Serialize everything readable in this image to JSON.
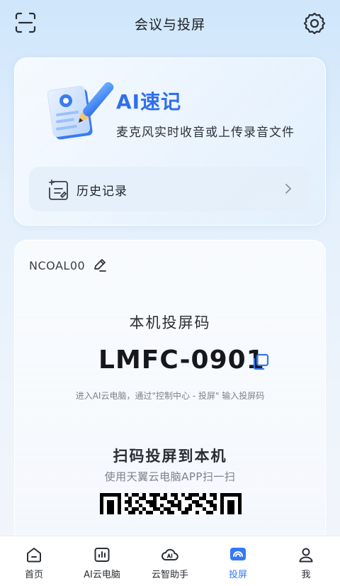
{
  "header": {
    "title": "会议与投屏",
    "scan_icon": "scan-icon",
    "settings_icon": "gear-icon"
  },
  "ai_card": {
    "title": "AI速记",
    "subtitle": "麦克风实时收音或上传录音文件",
    "history_label": "历史记录",
    "accent_color": "#2f6fed"
  },
  "projection": {
    "device_name": "NCOAL00",
    "code_title": "本机投屏码",
    "code": "LMFC-0901",
    "hint": "进入AI云电脑，通过\"控制中心 - 投屏\" 输入投屏码",
    "scan_title": "扫码投屏到本机",
    "scan_subtitle": "使用天翼云电脑APP扫一扫"
  },
  "nav": {
    "items": [
      {
        "label": "首页",
        "icon": "home-icon"
      },
      {
        "label": "AI云电脑",
        "icon": "chart-icon"
      },
      {
        "label": "云智助手",
        "icon": "ai-cloud-icon"
      },
      {
        "label": "投屏",
        "icon": "cast-icon"
      },
      {
        "label": "我",
        "icon": "user-icon"
      }
    ],
    "active_index": 3,
    "active_color": "#3478f6"
  }
}
